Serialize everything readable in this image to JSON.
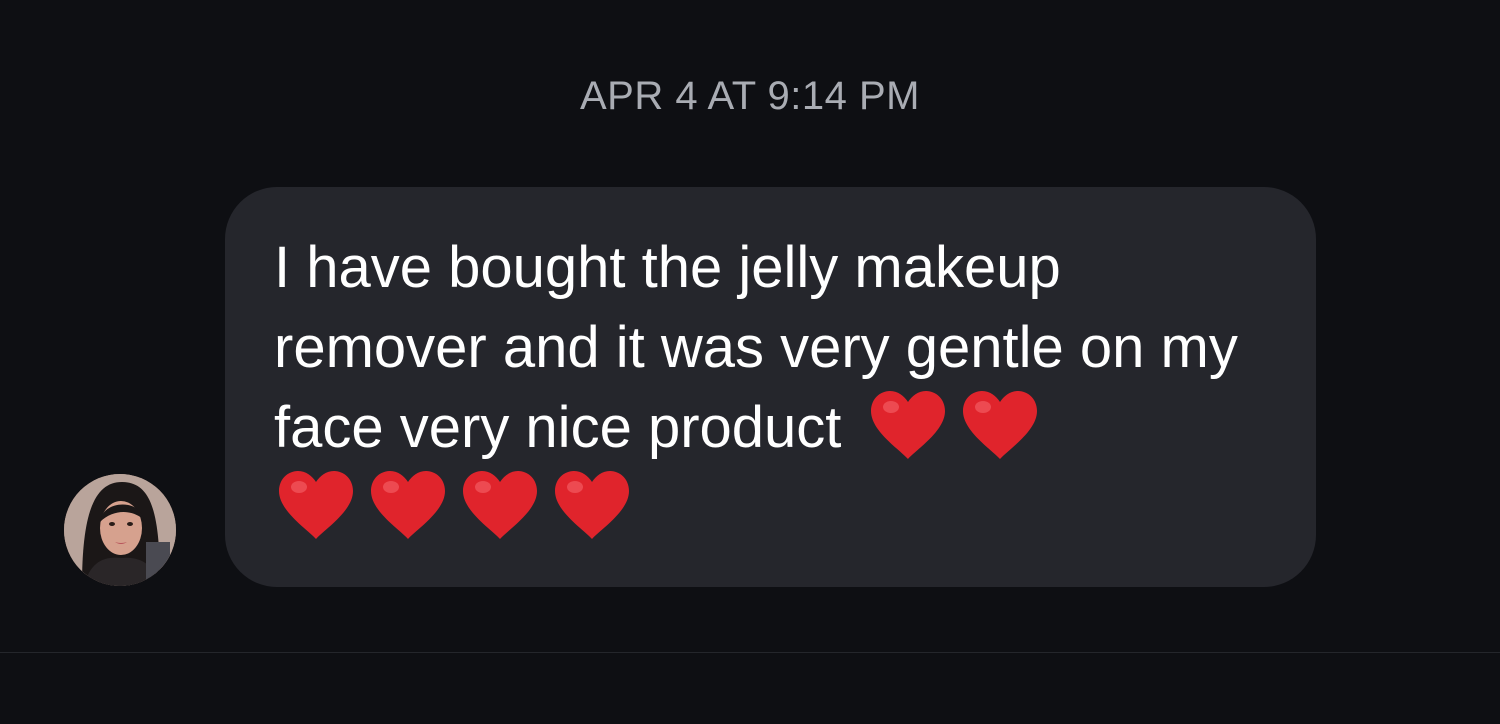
{
  "thread": {
    "timestamp": "APR 4 AT 9:14 PM"
  },
  "message": {
    "text": "I have bought the jelly makeup remover and it was very gentle on my face very nice product",
    "emoji": [
      "heart-emoji",
      "heart-emoji",
      "heart-emoji",
      "heart-emoji",
      "heart-emoji",
      "heart-emoji"
    ],
    "bubble_color": "#25262c",
    "text_color": "#ffffff"
  },
  "sender": {
    "avatar": "profile-photo"
  },
  "colors": {
    "background": "#0e0f13",
    "timestamp": "#a9acb3",
    "heart": "#e0242c"
  }
}
